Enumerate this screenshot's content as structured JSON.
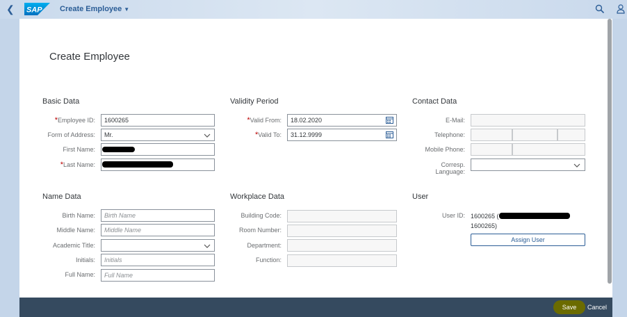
{
  "shell": {
    "logo_text": "SAP",
    "app_title": "Create Employee"
  },
  "page": {
    "title": "Create Employee"
  },
  "basic_data": {
    "title": "Basic Data",
    "employee_id_label": "Employee ID:",
    "employee_id_value": "1600265",
    "form_of_address_label": "Form of Address:",
    "form_of_address_value": "Mr.",
    "first_name_label": "First Name:",
    "last_name_label": "Last Name:"
  },
  "validity_period": {
    "title": "Validity Period",
    "valid_from_label": "Valid From:",
    "valid_from_value": "18.02.2020",
    "valid_to_label": "Valid To:",
    "valid_to_value": "31.12.9999"
  },
  "contact_data": {
    "title": "Contact Data",
    "email_label": "E-Mail:",
    "telephone_label": "Telephone:",
    "mobile_phone_label": "Mobile Phone:",
    "corresp_language_label_1": "Corresp.",
    "corresp_language_label_2": "Language:"
  },
  "name_data": {
    "title": "Name Data",
    "birth_name_label": "Birth Name:",
    "birth_name_placeholder": "Birth Name",
    "middle_name_label": "Middle Name:",
    "middle_name_placeholder": "Middle Name",
    "academic_title_label": "Academic Title:",
    "initials_label": "Initials:",
    "initials_placeholder": "Initials",
    "full_name_label": "Full Name:",
    "full_name_placeholder": "Full Name"
  },
  "workplace_data": {
    "title": "Workplace Data",
    "building_code_label": "Building Code:",
    "room_number_label": "Room Number:",
    "department_label": "Department:",
    "function_label": "Function:"
  },
  "user": {
    "title": "User",
    "user_id_label": "User ID:",
    "user_id_line1": "1600265 (",
    "user_id_line2": "1600265)",
    "assign_user_label": "Assign User"
  },
  "footer": {
    "save_label": "Save",
    "cancel_label": "Cancel"
  },
  "colors": {
    "shell_accent": "#2b5d96",
    "footer_bg": "#354a5f",
    "required": "#bb0000",
    "save_highlight": "#6b6b00"
  }
}
